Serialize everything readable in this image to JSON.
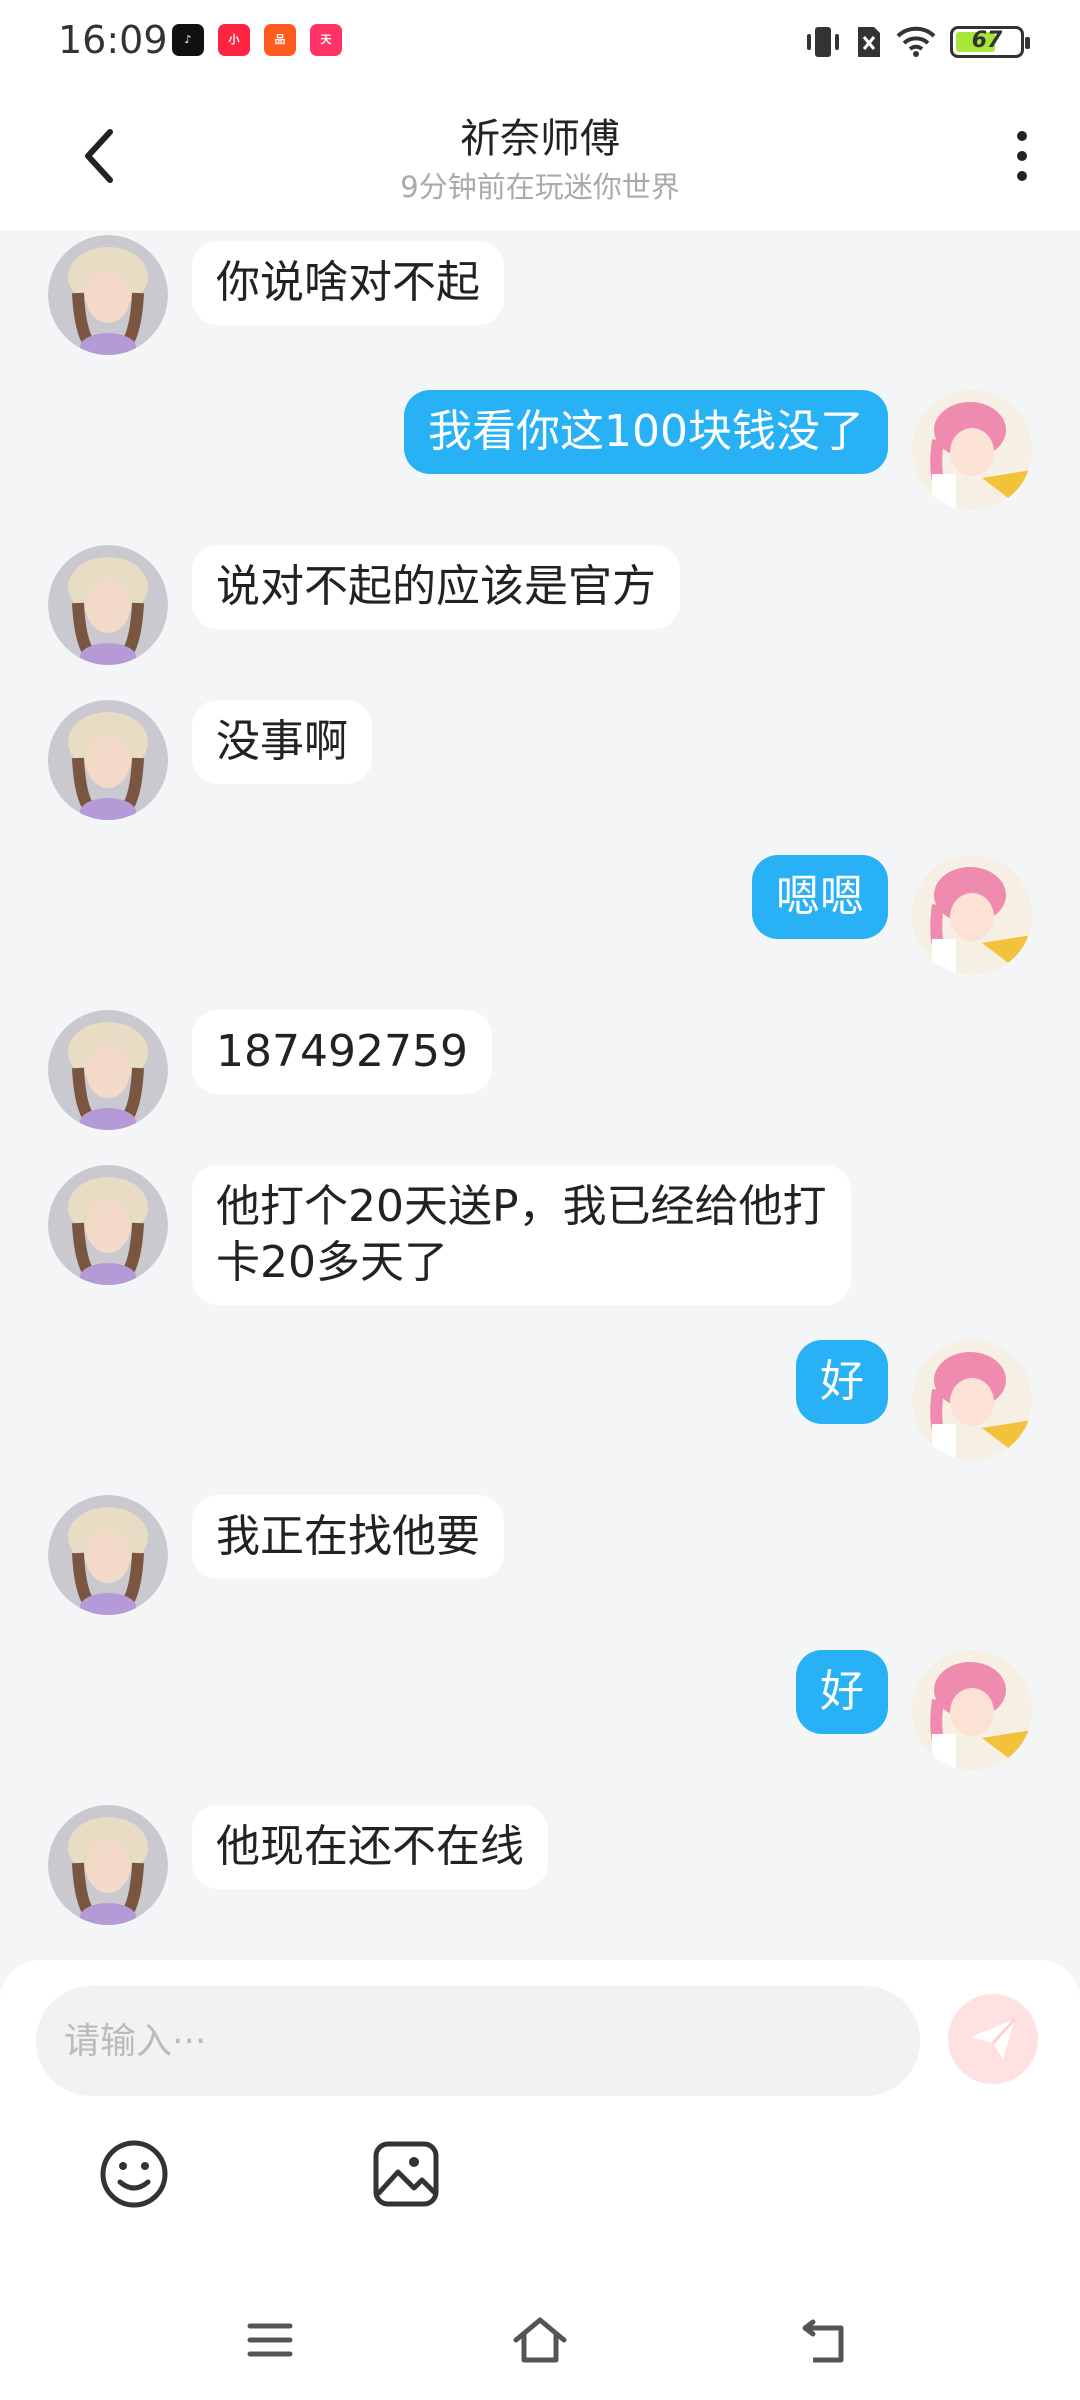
{
  "status": {
    "time": "16:09",
    "battery": "67",
    "notif_icons": [
      "tiktok-icon",
      "xiaohongshu-icon",
      "app-icon",
      "tmall-icon"
    ]
  },
  "header": {
    "title": "祈奈师傅",
    "subtitle": "9分钟前在玩迷你世界"
  },
  "messages": [
    {
      "side": "in",
      "text": "你说啥对不起"
    },
    {
      "side": "out",
      "text": "我看你这100块钱没了"
    },
    {
      "side": "in",
      "text": "说对不起的应该是官方"
    },
    {
      "side": "in",
      "text": "没事啊"
    },
    {
      "side": "out",
      "text": "嗯嗯"
    },
    {
      "side": "in",
      "text": "187492759"
    },
    {
      "side": "in",
      "text": "他打个20天送P，我已经给他打\n卡20多天了"
    },
    {
      "side": "out",
      "text": "好"
    },
    {
      "side": "in",
      "text": "我正在找他要"
    },
    {
      "side": "out",
      "text": "好"
    },
    {
      "side": "in",
      "text": "他现在还不在线"
    }
  ],
  "composer": {
    "placeholder": "请输入···"
  },
  "colors": {
    "accent": "#28b1f5",
    "send_bg": "#ffe1e1",
    "page_bg": "#f4f5f7"
  }
}
